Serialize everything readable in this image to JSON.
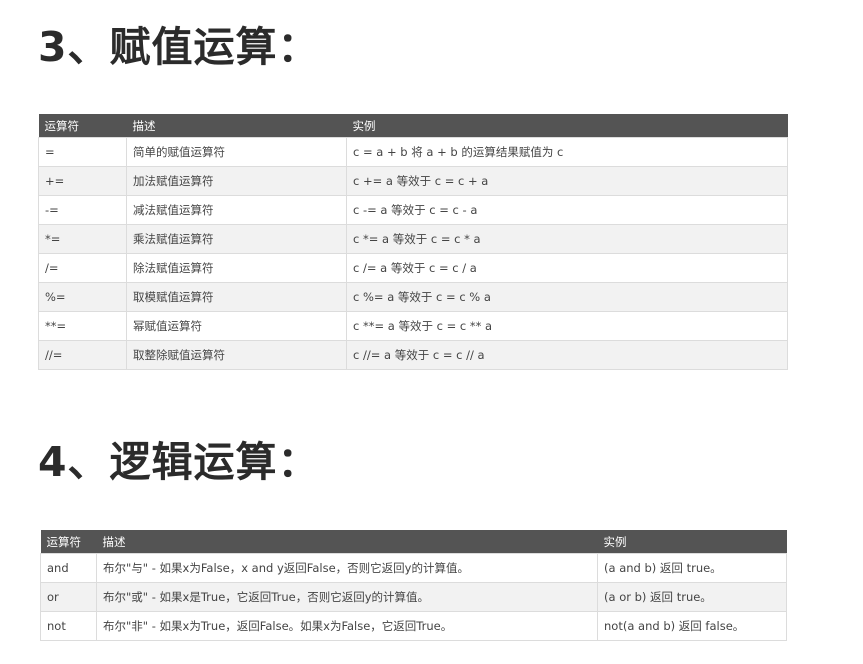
{
  "section1": {
    "heading": "3、赋值运算：",
    "headers": [
      "运算符",
      "描述",
      "实例"
    ],
    "rows": [
      [
        "=",
        "简单的赋值运算符",
        "c = a + b 将 a + b 的运算结果赋值为 c"
      ],
      [
        "+=",
        "加法赋值运算符",
        "c += a 等效于 c = c + a"
      ],
      [
        "-=",
        "减法赋值运算符",
        "c -= a 等效于 c = c - a"
      ],
      [
        "*=",
        "乘法赋值运算符",
        "c *= a 等效于 c = c * a"
      ],
      [
        "/=",
        "除法赋值运算符",
        "c /= a 等效于 c = c / a"
      ],
      [
        "%=",
        "取模赋值运算符",
        "c %= a 等效于 c = c % a"
      ],
      [
        "**=",
        "幂赋值运算符",
        "c **= a 等效于 c = c ** a"
      ],
      [
        "//=",
        "取整除赋值运算符",
        "c //= a 等效于 c = c // a"
      ]
    ]
  },
  "section2": {
    "heading": "4、逻辑运算：",
    "headers": [
      "运算符",
      "描述",
      "实例"
    ],
    "rows": [
      [
        "and",
        "布尔\"与\" - 如果x为False，x and y返回False，否则它返回y的计算值。",
        "(a and b) 返回 true。"
      ],
      [
        "or",
        "布尔\"或\" - 如果x是True，它返回True，否则它返回y的计算值。",
        "(a or b) 返回 true。"
      ],
      [
        "not",
        "布尔\"非\" - 如果x为True，返回False。如果x为False，它返回True。",
        "not(a and b) 返回 false。"
      ]
    ]
  }
}
